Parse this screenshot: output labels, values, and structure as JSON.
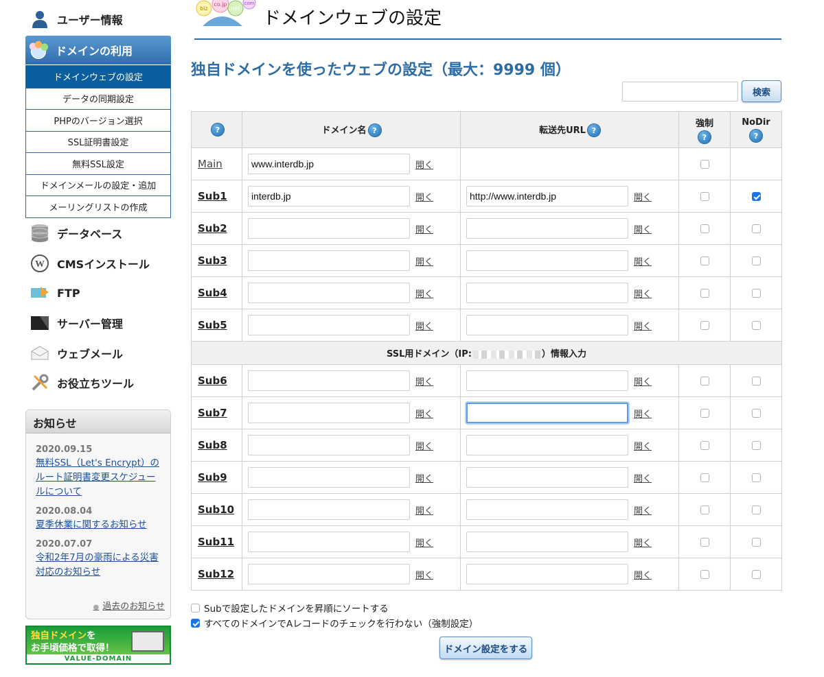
{
  "sidebar": {
    "user_info": "ユーザー情報",
    "domain_usage": "ドメインの利用",
    "submenu": [
      "ドメインウェブの設定",
      "データの同期設定",
      "PHPのバージョン選択",
      "SSL証明書設定",
      "無料SSL設定",
      "ドメインメールの設定・追加",
      "メーリングリストの作成"
    ],
    "active_submenu": "ドメインウェブの設定",
    "nav": [
      "データベース",
      "CMSインストール",
      "FTP",
      "サーバー管理",
      "ウェブメール",
      "お役立ちツール"
    ],
    "icons": [
      "person-icon",
      "globe-icon",
      "database-icon",
      "wordpress-icon",
      "ftp-icon",
      "server-icon",
      "webmail-icon",
      "tools-icon"
    ]
  },
  "notices": {
    "title": "お知らせ",
    "items": [
      {
        "date": "2020.09.15",
        "text": "無料SSL（Let's Encrypt）のルート証明書変更スケジュールについて"
      },
      {
        "date": "2020.08.04",
        "text": "夏季休業に関するお知らせ"
      },
      {
        "date": "2020.07.07",
        "text": "令和2年7月の豪雨による災害対応のお知らせ"
      }
    ],
    "past_link": "過去のお知らせ"
  },
  "banner": {
    "line1_highlight": "独自ドメイン",
    "line1_rest": "を",
    "line2": "お手頃価格で取得！",
    "brand": "VALUE-DOMAIN"
  },
  "header": {
    "logo_labels": [
      "biz",
      "co.jp",
      "net",
      "com"
    ],
    "title": "ドメインウェブの設定"
  },
  "section": {
    "title": "独自ドメインを使ったウェブの設定（最大：9999 個）"
  },
  "search": {
    "value": "",
    "button": "検索"
  },
  "table": {
    "headers": {
      "help": "?",
      "domain": "ドメイン名",
      "redirect": "転送先URL",
      "force": "強制",
      "nodir": "NoDir"
    },
    "open_label": "開く",
    "ssl_divider_prefix": "SSL用ドメイン（IP:",
    "ssl_divider_suffix": "）情報入力",
    "rows": [
      {
        "label": "Main",
        "domain": "www.interdb.jp",
        "url": "",
        "has_url": false,
        "force": false,
        "nodir": false,
        "has_nodir": false
      },
      {
        "label": "Sub1",
        "domain": "interdb.jp",
        "url": "http://www.interdb.jp",
        "has_url": true,
        "force": false,
        "nodir": true,
        "has_nodir": true
      },
      {
        "label": "Sub2",
        "domain": "",
        "url": "",
        "has_url": true,
        "force": false,
        "nodir": false,
        "has_nodir": true
      },
      {
        "label": "Sub3",
        "domain": "",
        "url": "",
        "has_url": true,
        "force": false,
        "nodir": false,
        "has_nodir": true
      },
      {
        "label": "Sub4",
        "domain": "",
        "url": "",
        "has_url": true,
        "force": false,
        "nodir": false,
        "has_nodir": true
      },
      {
        "label": "Sub5",
        "domain": "",
        "url": "",
        "has_url": true,
        "force": false,
        "nodir": false,
        "has_nodir": true
      },
      {
        "label": "Sub6",
        "domain": "",
        "url": "",
        "has_url": true,
        "force": false,
        "nodir": false,
        "has_nodir": true
      },
      {
        "label": "Sub7",
        "domain": "",
        "url": "",
        "has_url": true,
        "force": false,
        "nodir": false,
        "has_nodir": true,
        "focused": true
      },
      {
        "label": "Sub8",
        "domain": "",
        "url": "",
        "has_url": true,
        "force": false,
        "nodir": false,
        "has_nodir": true
      },
      {
        "label": "Sub9",
        "domain": "",
        "url": "",
        "has_url": true,
        "force": false,
        "nodir": false,
        "has_nodir": true
      },
      {
        "label": "Sub10",
        "domain": "",
        "url": "",
        "has_url": true,
        "force": false,
        "nodir": false,
        "has_nodir": true
      },
      {
        "label": "Sub11",
        "domain": "",
        "url": "",
        "has_url": true,
        "force": false,
        "nodir": false,
        "has_nodir": true
      },
      {
        "label": "Sub12",
        "domain": "",
        "url": "",
        "has_url": true,
        "force": false,
        "nodir": false,
        "has_nodir": true
      }
    ]
  },
  "options": {
    "sort_label": "Subで設定したドメインを昇順にソートする",
    "sort_checked": false,
    "arecord_label": "すべてのドメインでAレコードのチェックを行わない（強制設定）",
    "arecord_checked": true
  },
  "submit_label": "ドメイン設定をする",
  "colors": {
    "accent": "#2e6ca6",
    "active_menu": "#0c5f9e",
    "checkbox_checked": "#1a74e8"
  }
}
